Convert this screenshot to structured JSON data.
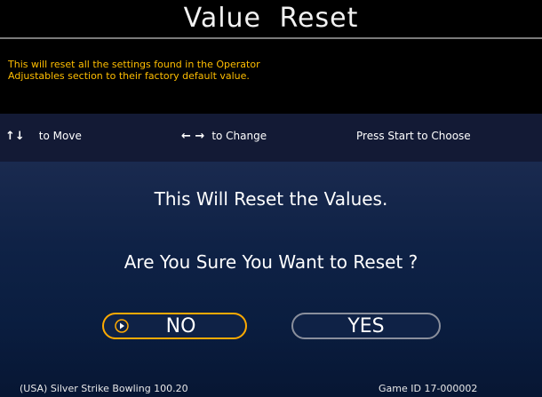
{
  "screen": {
    "title": "Value Reset",
    "description_line_1": "This will reset all the settings found in the Operator",
    "description_line_2": "Adjustables section to their factory default value."
  },
  "controls": {
    "move_arrows": "↑↓",
    "move_label": "to Move",
    "change_arrows": "← →",
    "change_label": "to Change",
    "choose_label": "Press Start to Choose"
  },
  "dialog": {
    "message": "This Will Reset the Values.",
    "question": "Are You Sure You Want to Reset ?",
    "no_label": "NO",
    "yes_label": "YES",
    "selected": "NO"
  },
  "footer": {
    "game_info": "(USA) Silver Strike Bowling 100.20",
    "game_id": "Game ID 17-000002"
  },
  "icons": {
    "selector": "right-triangle-in-circle-icon"
  },
  "colors": {
    "description_text": "#ffbe00",
    "selected_border": "#ffaa00",
    "unselected_border": "#8a8f9c",
    "controls_bg": "#131a35",
    "main_bg": "#0f2246"
  }
}
